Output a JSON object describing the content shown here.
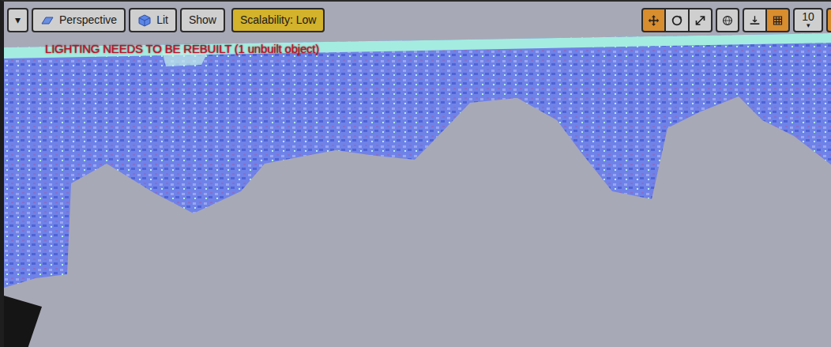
{
  "toolbar": {
    "menu": {
      "label": "▾"
    },
    "view_buttons": [
      {
        "label": "Perspective",
        "kind": "perspective"
      },
      {
        "label": "Lit",
        "kind": "lit"
      },
      {
        "label": "Show",
        "kind": "plain"
      }
    ],
    "scalability": {
      "label": "Scalability: Low"
    },
    "transform_tools": [
      {
        "kind": "move",
        "selected": true
      },
      {
        "kind": "rotate",
        "selected": false
      },
      {
        "kind": "scale",
        "selected": false
      }
    ],
    "snap_tools": [
      {
        "kind": "world",
        "selected": false
      },
      {
        "kind": "surface",
        "selected": false
      },
      {
        "kind": "grid",
        "selected": true
      }
    ],
    "grid_size": {
      "value": "10",
      "arrow": "▾"
    },
    "overflow_tool": {
      "kind": "rotation",
      "selected": true
    }
  },
  "viewport": {
    "warning": "LIGHTING NEEDS TO BE REBUILT (1 unbuilt object)"
  }
}
